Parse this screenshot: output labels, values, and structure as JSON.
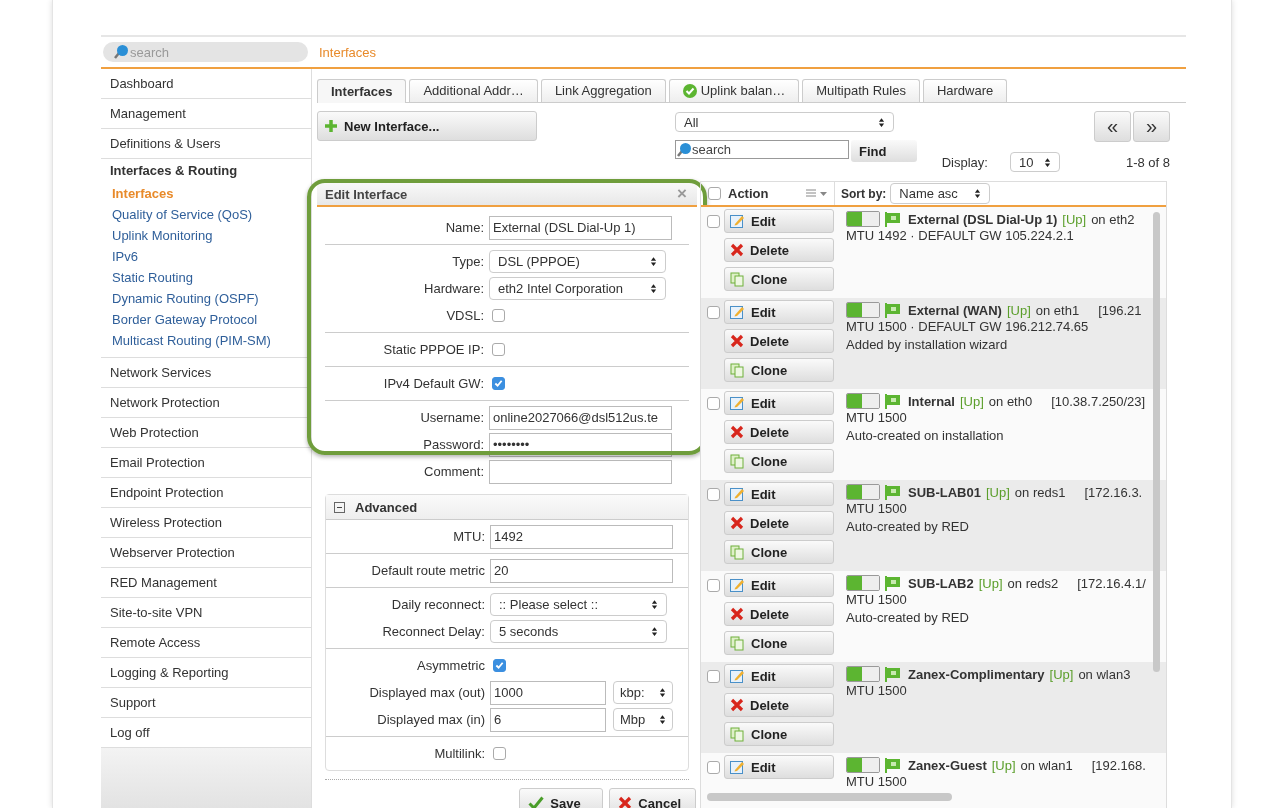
{
  "sidebar": {
    "search": {
      "placeholder": "search"
    },
    "items": [
      {
        "label": "Dashboard",
        "expanded": false
      },
      {
        "label": "Management",
        "expanded": false
      },
      {
        "label": "Definitions & Users",
        "expanded": false
      },
      {
        "label": "Interfaces & Routing",
        "expanded": true,
        "children": [
          {
            "label": "Interfaces",
            "selected": true
          },
          {
            "label": "Quality of Service (QoS)",
            "selected": false
          },
          {
            "label": "Uplink Monitoring",
            "selected": false
          },
          {
            "label": "IPv6",
            "selected": false
          },
          {
            "label": "Static Routing",
            "selected": false
          },
          {
            "label": "Dynamic Routing (OSPF)",
            "selected": false
          },
          {
            "label": "Border Gateway Protocol",
            "selected": false
          },
          {
            "label": "Multicast Routing (PIM-SM)",
            "selected": false
          }
        ]
      },
      {
        "label": "Network Services",
        "expanded": false
      },
      {
        "label": "Network Protection",
        "expanded": false
      },
      {
        "label": "Web Protection",
        "expanded": false
      },
      {
        "label": "Email Protection",
        "expanded": false
      },
      {
        "label": "Endpoint Protection",
        "expanded": false
      },
      {
        "label": "Wireless Protection",
        "expanded": false
      },
      {
        "label": "Webserver Protection",
        "expanded": false
      },
      {
        "label": "RED Management",
        "expanded": false
      },
      {
        "label": "Site-to-site VPN",
        "expanded": false
      },
      {
        "label": "Remote Access",
        "expanded": false
      },
      {
        "label": "Logging & Reporting",
        "expanded": false
      },
      {
        "label": "Support",
        "expanded": false
      },
      {
        "label": "Log off",
        "expanded": false
      }
    ]
  },
  "breadcrumb": "Interfaces",
  "tabs": [
    {
      "label": "Interfaces",
      "selected": true,
      "status_icon": false
    },
    {
      "label": "Additional Addr…",
      "selected": false,
      "status_icon": false
    },
    {
      "label": "Link Aggregation",
      "selected": false,
      "status_icon": false
    },
    {
      "label": "Uplink balan…",
      "selected": false,
      "status_icon": true
    },
    {
      "label": "Multipath Rules",
      "selected": false,
      "status_icon": false
    },
    {
      "label": "Hardware",
      "selected": false,
      "status_icon": false
    }
  ],
  "toolbar": {
    "new_button": "New Interface...",
    "filter": "All",
    "search": {
      "placeholder": "search"
    },
    "find_button": "Find",
    "pager": [
      "«",
      "»"
    ],
    "display_label": "Display:",
    "display_value": "10",
    "count": "1-8 of 8"
  },
  "edit_panel": {
    "title": "Edit Interface",
    "close": "×",
    "groups": [
      [
        {
          "kind": "text",
          "label": "Name:",
          "value": "External (DSL Dial-Up 1)"
        }
      ],
      [
        {
          "kind": "select",
          "label": "Type:",
          "value": "DSL (PPPOE)"
        },
        {
          "kind": "select",
          "label": "Hardware:",
          "value": "eth2 Intel Corporation"
        },
        {
          "kind": "checkbox",
          "label": "VDSL:",
          "checked": false
        }
      ],
      [
        {
          "kind": "checkbox",
          "label": "Static PPPOE IP:",
          "checked": false
        }
      ],
      [
        {
          "kind": "checkbox",
          "label": "IPv4 Default GW:",
          "checked": true
        }
      ],
      [
        {
          "kind": "text",
          "label": "Username:",
          "value": "online2027066@dsl512us.te"
        },
        {
          "kind": "text",
          "label": "Password:",
          "value": "••••••••"
        },
        {
          "kind": "text",
          "label": "Comment:"
        }
      ]
    ],
    "advanced": {
      "title": "Advanced",
      "expanded": true,
      "groups": [
        [
          {
            "kind": "text",
            "label": "MTU:",
            "value": "1492"
          }
        ],
        [
          {
            "kind": "text",
            "label": "Default route metric",
            "value": "20"
          }
        ],
        [
          {
            "kind": "select",
            "label": "Daily reconnect:",
            "value": ":: Please select ::"
          },
          {
            "kind": "select",
            "label": "Reconnect Delay:",
            "value": "5 seconds"
          }
        ],
        [
          {
            "kind": "checkbox",
            "label": "Asymmetric",
            "checked": true
          },
          {
            "kind": "text",
            "label": "Displayed max (out)",
            "value": "1000",
            "unit": "kbp:"
          },
          {
            "kind": "text",
            "label": "Displayed max (in)",
            "value": "6",
            "unit": "Mbp"
          }
        ],
        [
          {
            "kind": "checkbox",
            "label": "Multilink:",
            "checked": false
          }
        ]
      ]
    },
    "buttons": [
      {
        "kind": "save",
        "label": "Save"
      },
      {
        "kind": "cancel",
        "label": "Cancel"
      }
    ]
  },
  "list": {
    "select_all_checked": false,
    "action_header": "Action",
    "sort_label": "Sort by:",
    "sort_value": "Name asc",
    "rows": [
      {
        "checked": false,
        "enabled": true,
        "name": "External (DSL Dial-Up 1)",
        "status": "[Up]",
        "port": "on eth2",
        "details": [
          "MTU 1492 · DEFAULT GW 105.224.2.1"
        ],
        "actions": [
          {
            "kind": "edit",
            "label": "Edit"
          },
          {
            "kind": "delete",
            "label": "Delete"
          },
          {
            "kind": "clone",
            "label": "Clone"
          }
        ]
      },
      {
        "checked": false,
        "enabled": true,
        "name": "External (WAN)",
        "status": "[Up]",
        "port": "on eth1",
        "address": "[196.21",
        "details": [
          "MTU 1500 · DEFAULT GW 196.212.74.65",
          "Added by installation wizard"
        ],
        "actions": [
          {
            "kind": "edit",
            "label": "Edit"
          },
          {
            "kind": "delete",
            "label": "Delete"
          },
          {
            "kind": "clone",
            "label": "Clone"
          }
        ]
      },
      {
        "checked": false,
        "enabled": true,
        "name": "Internal",
        "status": "[Up]",
        "port": "on eth0",
        "address": "[10.38.7.250/23]",
        "details": [
          "MTU 1500",
          "Auto-created on installation"
        ],
        "actions": [
          {
            "kind": "edit",
            "label": "Edit"
          },
          {
            "kind": "delete",
            "label": "Delete"
          },
          {
            "kind": "clone",
            "label": "Clone"
          }
        ]
      },
      {
        "checked": false,
        "enabled": true,
        "name": "SUB-LAB01",
        "status": "[Up]",
        "port": "on reds1",
        "address": "[172.16.3.",
        "details": [
          "MTU 1500",
          "Auto-created by RED"
        ],
        "actions": [
          {
            "kind": "edit",
            "label": "Edit"
          },
          {
            "kind": "delete",
            "label": "Delete"
          },
          {
            "kind": "clone",
            "label": "Clone"
          }
        ]
      },
      {
        "checked": false,
        "enabled": true,
        "name": "SUB-LAB2",
        "status": "[Up]",
        "port": "on reds2",
        "address": "[172.16.4.1/",
        "details": [
          "MTU 1500",
          "Auto-created by RED"
        ],
        "actions": [
          {
            "kind": "edit",
            "label": "Edit"
          },
          {
            "kind": "delete",
            "label": "Delete"
          },
          {
            "kind": "clone",
            "label": "Clone"
          }
        ]
      },
      {
        "checked": false,
        "enabled": true,
        "name": "Zanex-Complimentary",
        "status": "[Up]",
        "port": "on wlan3",
        "details": [
          "MTU 1500"
        ],
        "actions": [
          {
            "kind": "edit",
            "label": "Edit"
          },
          {
            "kind": "delete",
            "label": "Delete"
          },
          {
            "kind": "clone",
            "label": "Clone"
          }
        ]
      },
      {
        "checked": false,
        "enabled": true,
        "name": "Zanex-Guest",
        "status": "[Up]",
        "port": "on wlan1",
        "address": "[192.168.",
        "details": [
          "MTU 1500"
        ],
        "actions": [
          {
            "kind": "edit",
            "label": "Edit"
          }
        ]
      }
    ]
  }
}
